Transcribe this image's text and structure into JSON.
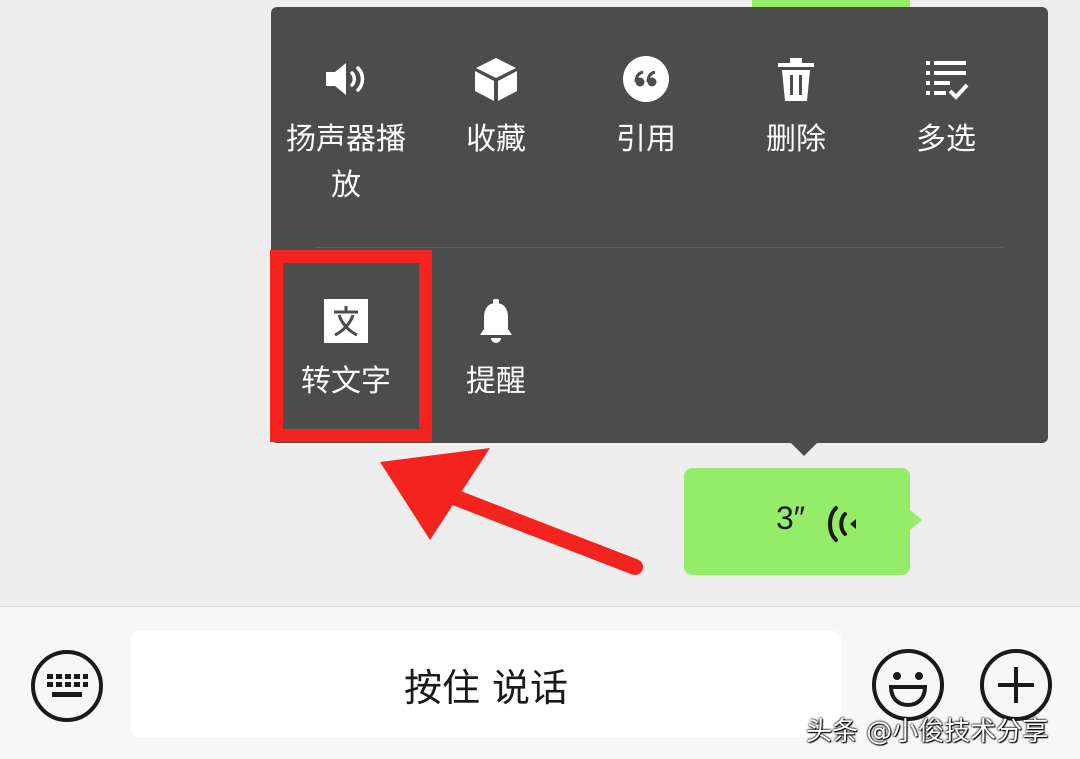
{
  "menu": {
    "row1": [
      {
        "label": "扬声器播放",
        "icon": "speaker-icon"
      },
      {
        "label": "收藏",
        "icon": "cube-icon"
      },
      {
        "label": "引用",
        "icon": "quote-icon"
      },
      {
        "label": "删除",
        "icon": "trash-icon"
      },
      {
        "label": "多选",
        "icon": "multiselect-icon"
      }
    ],
    "row2": [
      {
        "label": "转文字",
        "icon": "translate-text-icon"
      },
      {
        "label": "提醒",
        "icon": "bell-icon"
      }
    ],
    "background_color": "#4c4c4c",
    "highlight_color": "#f5231d"
  },
  "voice_message": {
    "duration": "3″",
    "bubble_color": "#95ec69"
  },
  "input_bar": {
    "talk_label": "按住 说话",
    "keyboard_icon": "keyboard-icon",
    "emoji_icon": "smiley-icon",
    "plus_icon": "plus-icon"
  },
  "watermark": "头条 @小俊技术分享"
}
